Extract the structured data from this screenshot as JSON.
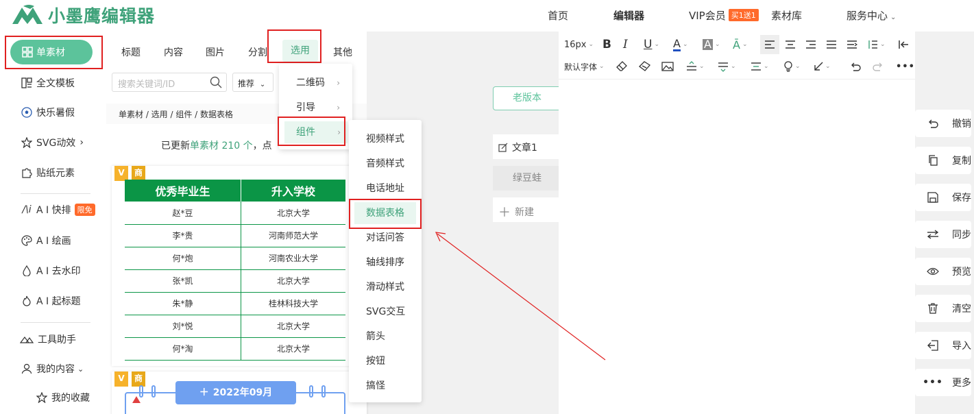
{
  "header": {
    "logo_text": "小墨鹰编辑器",
    "nav": [
      {
        "label": "首页"
      },
      {
        "label": "编辑器"
      },
      {
        "label": "VIP会员",
        "badge": "买1送1"
      },
      {
        "label": "素材库"
      },
      {
        "label": "服务中心"
      }
    ]
  },
  "sidebar": {
    "active": "单素材",
    "items": [
      {
        "label": "全文模板",
        "icon": "template-icon"
      },
      {
        "label": "快乐暑假",
        "icon": "soccer-ball-icon"
      },
      {
        "label": "SVG动效",
        "icon": "star-icon"
      },
      {
        "label": "贴纸元素",
        "icon": "puzzle-icon"
      },
      {
        "label": "A I 快排",
        "icon": "ai-icon",
        "badge": "限免"
      },
      {
        "label": "A I 绘画",
        "icon": "palette-icon"
      },
      {
        "label": "A I 去水印",
        "icon": "drop-icon"
      },
      {
        "label": "A I 起标题",
        "icon": "flame-icon"
      },
      {
        "label": "工具助手",
        "icon": "tools-icon"
      },
      {
        "label": "我的内容",
        "icon": "user-icon"
      },
      {
        "label": "我的收藏",
        "icon": "star-outline-icon"
      }
    ]
  },
  "panel": {
    "tabs": [
      "标题",
      "内容",
      "图片",
      "分割",
      "选用",
      "其他"
    ],
    "active_tab": "选用",
    "search_placeholder": "搜索关键词/ID",
    "sort_label": "推荐",
    "breadcrumb": "单素材 / 选用 / 组件 / 数据表格",
    "update_prefix": "已更新",
    "update_highlight": "单素材 210 个",
    "update_suffix": "，点",
    "tag_v": "V",
    "tag_shop": "商",
    "table": {
      "headers": [
        "优秀毕业生",
        "升入学校"
      ],
      "rows": [
        [
          "赵*豆",
          "北京大学"
        ],
        [
          "李*贵",
          "河南师范大学"
        ],
        [
          "何*炮",
          "河南农业大学"
        ],
        [
          "张*凯",
          "北京大学"
        ],
        [
          "朱*静",
          "桂林科技大学"
        ],
        [
          "刘*悦",
          "北京大学"
        ],
        [
          "何*淘",
          "北京大学"
        ]
      ]
    },
    "calendar_title": "2022年09月"
  },
  "menu1": {
    "items": [
      "二维码",
      "引导",
      "组件"
    ],
    "selected": "组件"
  },
  "menu2": {
    "items": [
      "视频样式",
      "音频样式",
      "电话地址",
      "数据表格",
      "对话问答",
      "轴线排序",
      "滑动样式",
      "SVG交互",
      "箭头",
      "按钮",
      "搞怪"
    ],
    "selected": "数据表格"
  },
  "articles": {
    "old_version": "老版本",
    "doc1": "文章1",
    "doc2": "绿豆蛙",
    "new": "新建"
  },
  "editor": {
    "font_size": "16px",
    "font_family": "默认字体"
  },
  "actions": [
    {
      "label": "撤销",
      "icon": "undo-icon"
    },
    {
      "label": "复制",
      "icon": "copy-icon"
    },
    {
      "label": "保存",
      "icon": "save-icon"
    },
    {
      "label": "同步",
      "icon": "sync-icon"
    },
    {
      "label": "预览",
      "icon": "eye-icon"
    },
    {
      "label": "清空",
      "icon": "trash-icon"
    },
    {
      "label": "导入",
      "icon": "import-icon"
    },
    {
      "label": "更多",
      "icon": "more-icon"
    }
  ],
  "colors": {
    "brand": "#3fa27a",
    "active_bg": "#5cc39b",
    "table_green": "#0b9546",
    "highlight_red": "#e02020",
    "badge_orange": "#ff6a2b"
  }
}
